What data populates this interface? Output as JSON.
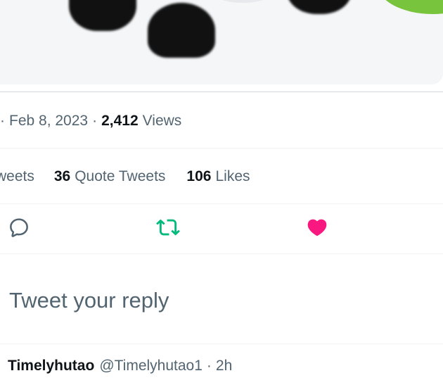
{
  "tweet": {
    "meta": {
      "leading_separator": "·",
      "date": "Feb 8, 2023",
      "separator": "·",
      "views_count": "2,412",
      "views_label": "Views"
    },
    "stats": {
      "retweets_label_partial": "weets",
      "quote_count": "36",
      "quote_label": "Quote Tweets",
      "likes_count": "106",
      "likes_label": "Likes"
    },
    "actions": {
      "reply_icon": "reply-icon",
      "retweet_icon": "retweet-icon",
      "like_icon": "heart-icon"
    }
  },
  "reply": {
    "placeholder": "Tweet your reply"
  },
  "next_tweet": {
    "display_name": "Timelyhutao",
    "handle": "@Timelyhutao1",
    "separator": "·",
    "time": "2h"
  },
  "colors": {
    "retweet_active": "#00ba7c",
    "like_active": "#f91880",
    "secondary_text": "#536471",
    "primary_text": "#0f1419"
  }
}
